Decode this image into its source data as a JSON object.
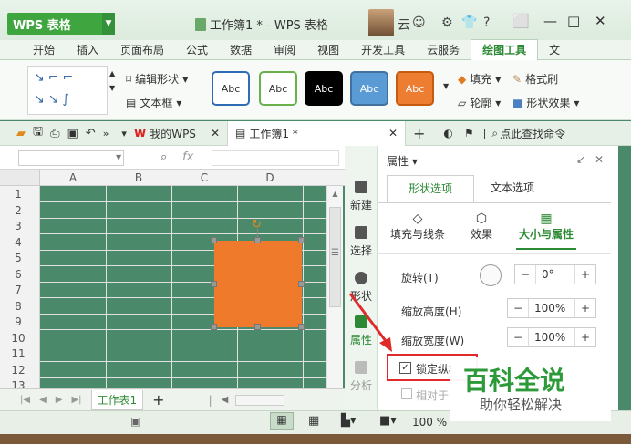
{
  "app": {
    "name": "WPS 表格",
    "doc_title": "工作簿1 * - WPS 表格",
    "user": "云"
  },
  "menu": [
    "开始",
    "插入",
    "页面布局",
    "公式",
    "数据",
    "审阅",
    "视图",
    "开发工具",
    "云服务",
    "绘图工具",
    "文"
  ],
  "ribbon": {
    "edit_shape": "编辑形状",
    "text_box": "文本框",
    "styles": [
      {
        "label": "Abc",
        "bg": "#ffffff",
        "border": "#2e6db5",
        "color": "#333333"
      },
      {
        "label": "Abc",
        "bg": "#ffffff",
        "border": "#6ab04c",
        "color": "#333333"
      },
      {
        "label": "Abc",
        "bg": "#000000",
        "border": "#000000",
        "color": "#ffffff"
      },
      {
        "label": "Abc",
        "bg": "#5b9bd5",
        "border": "#41719c",
        "color": "#ffffff"
      },
      {
        "label": "Abc",
        "bg": "#ed7d31",
        "border": "#c55a11",
        "color": "#ffffff"
      }
    ],
    "fill": "填充",
    "format_painter": "格式刷",
    "outline": "轮廓",
    "shape_effects": "形状效果"
  },
  "tabs": {
    "my_wps": "我的WPS",
    "workbook": "工作簿1 *",
    "search": "点此查找命令"
  },
  "formula": {
    "fx": "fx"
  },
  "columns": [
    "A",
    "B",
    "C",
    "D"
  ],
  "rows": [
    "1",
    "2",
    "3",
    "4",
    "5",
    "6",
    "7",
    "8",
    "9",
    "10",
    "11",
    "12",
    "13"
  ],
  "sheet_tab": "工作表1",
  "side_buttons": [
    "新建",
    "选择",
    "形状",
    "属性",
    "分析"
  ],
  "panel": {
    "title": "属性",
    "tab_shape": "形状选项",
    "tab_text": "文本选项",
    "sub_fill": "填充与线条",
    "sub_effect": "效果",
    "sub_size": "大小与属性",
    "rotate_label": "旋转(T)",
    "rotate_value": "0°",
    "height_label": "缩放高度(H)",
    "height_value": "100%",
    "width_label": "缩放宽度(W)",
    "width_value": "100%",
    "lock_label": "锁定纵横比",
    "relative_label": "相对于图"
  },
  "status": {
    "zoom": "100 %"
  },
  "watermark": {
    "title": "百科全说",
    "subtitle": "助你轻松解决"
  }
}
